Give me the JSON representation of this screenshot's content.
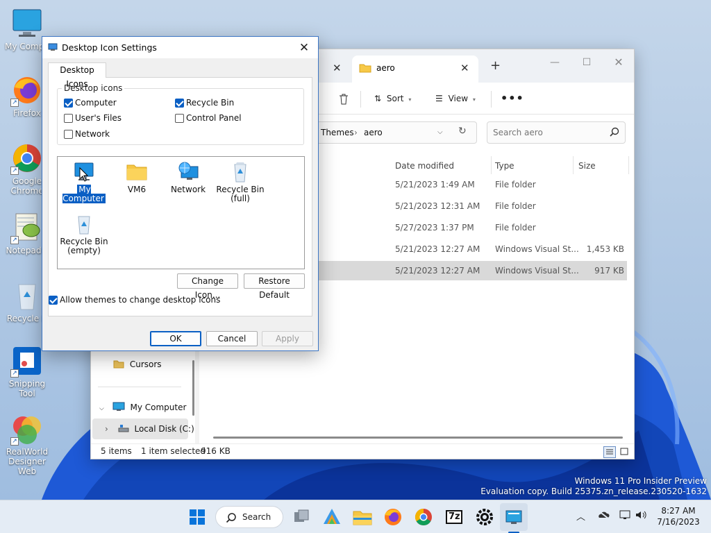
{
  "desktop": {
    "icons": [
      {
        "label": "My Compu",
        "icon": "computer-icon"
      },
      {
        "label": "Firefox",
        "icon": "firefox-icon"
      },
      {
        "label": "Google Chrome",
        "icon": "chrome-icon"
      },
      {
        "label": "Notepad+",
        "icon": "notepadpp-icon"
      },
      {
        "label": "Recycle B",
        "icon": "recycle-bin-icon"
      },
      {
        "label": "Snipping Tool",
        "icon": "snipping-tool-icon"
      },
      {
        "label": "RealWorld Designer Web",
        "icon": "realworld-icon"
      }
    ],
    "watermark_line1": "Windows 11 Pro Insider Preview",
    "watermark_line2": "Evaluation copy. Build 25375.zn_release.230520-1632"
  },
  "explorer": {
    "tab_title": "aero",
    "toolbar": {
      "sort": "Sort",
      "view": "View",
      "more": "•••"
    },
    "breadcrumb": [
      "Themes",
      "aero"
    ],
    "search_placeholder": "Search aero",
    "columns": [
      "Date modified",
      "Type",
      "Size"
    ],
    "rows": [
      {
        "date": "5/21/2023 1:49 AM",
        "type": "File folder",
        "size": ""
      },
      {
        "date": "5/21/2023 12:31 AM",
        "type": "File folder",
        "size": ""
      },
      {
        "date": "5/27/2023 1:37 PM",
        "type": "File folder",
        "size": ""
      },
      {
        "date": "5/21/2023 12:27 AM",
        "type": "Windows Visual St...",
        "size": "1,453 KB"
      },
      {
        "date": "5/21/2023 12:27 AM",
        "type": "Windows Visual St...",
        "size": "917 KB"
      }
    ],
    "nav": {
      "cursors": "Cursors",
      "my_computer": "My Computer",
      "local_disk": "Local Disk (C:)"
    },
    "status": {
      "items": "5 items",
      "selected": "1 item selected",
      "size": "916 KB"
    }
  },
  "dialog": {
    "title": "Desktop Icon Settings",
    "tab": "Desktop Icons",
    "group_label": "Desktop icons",
    "checkboxes": [
      {
        "label": "Computer",
        "checked": true
      },
      {
        "label": "Recycle Bin",
        "checked": true
      },
      {
        "label": "User's Files",
        "checked": false
      },
      {
        "label": "Control Panel",
        "checked": false
      },
      {
        "label": "Network",
        "checked": false
      }
    ],
    "icons": [
      {
        "label": "My Computer",
        "icon": "computer-icon",
        "selected": true
      },
      {
        "label": "VM6",
        "icon": "folder-icon"
      },
      {
        "label": "Network",
        "icon": "network-icon"
      },
      {
        "label": "Recycle Bin (full)",
        "icon": "recycle-bin-full-icon"
      },
      {
        "label": "Recycle Bin (empty)",
        "icon": "recycle-bin-empty-icon"
      }
    ],
    "change_icon": "Change Icon...",
    "restore_default": "Restore Default",
    "allow_themes": "Allow themes to change desktop icons",
    "allow_themes_checked": true,
    "ok": "OK",
    "cancel": "Cancel",
    "apply": "Apply"
  },
  "taskbar": {
    "search": "Search",
    "time": "8:27 AM",
    "date": "7/16/2023",
    "seven_zip": "7z"
  },
  "colors": {
    "accent": "#0a5fc4",
    "taskbar": "#e4ecf5",
    "selection_row": "#d9d9d9"
  }
}
